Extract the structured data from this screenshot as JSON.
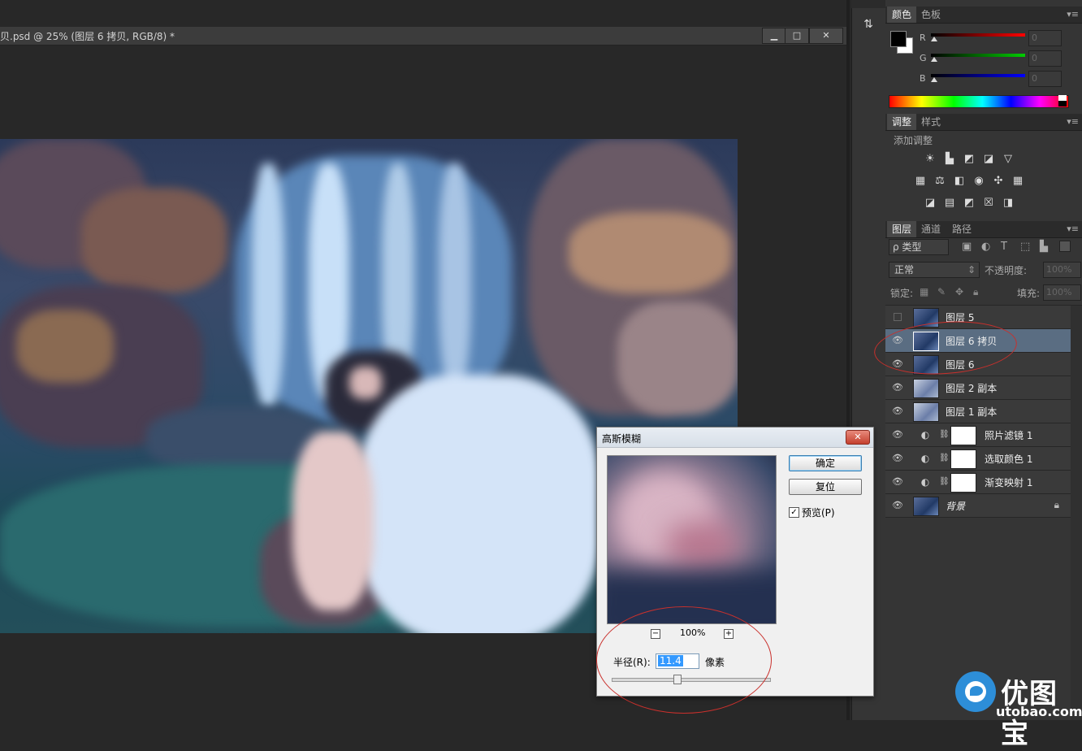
{
  "document": {
    "title": "贝.psd @ 25% (图层 6 拷贝, RGB/8) *",
    "btn_minimize": "▁",
    "btn_restore": "□",
    "btn_close": "✕"
  },
  "color_panel": {
    "tabs": [
      "颜色",
      "色板"
    ],
    "channels": [
      {
        "label": "R",
        "value": "0",
        "color": "#ff0000"
      },
      {
        "label": "G",
        "value": "0",
        "color": "#00cc00"
      },
      {
        "label": "B",
        "value": "0",
        "color": "#0000ff"
      }
    ],
    "foreground": "#000000",
    "background": "#ffffff"
  },
  "adjustments_panel": {
    "tabs": [
      "调整",
      "样式"
    ],
    "heading": "添加调整",
    "icons": [
      [
        "brightness-icon",
        "levels-icon",
        "curves-icon",
        "exposure-icon",
        "vibrance-icon"
      ],
      [
        "hue-saturation-icon",
        "color-balance-icon",
        "black-white-icon",
        "photo-filter-icon",
        "channel-mixer-icon",
        "color-lookup-icon"
      ],
      [
        "invert-icon",
        "posterize-icon",
        "threshold-icon",
        "gradient-map-icon",
        "selective-color-icon"
      ]
    ]
  },
  "layers_panel": {
    "tabs": [
      "图层",
      "通道",
      "路径"
    ],
    "filter_kind": "ρ 类型",
    "blend_mode": "正常",
    "opacity_label": "不透明度:",
    "opacity_value": "100%",
    "lock_label": "锁定:",
    "fill_label": "填充:",
    "fill_value": "100%",
    "layers": [
      {
        "name": "图层 5",
        "visible": false,
        "type": "pixel",
        "selected": false
      },
      {
        "name": "图层 6 拷贝",
        "visible": true,
        "type": "pixel",
        "selected": true
      },
      {
        "name": "图层 6",
        "visible": true,
        "type": "pixel",
        "selected": false
      },
      {
        "name": "图层 2 副本",
        "visible": true,
        "type": "pixel-light",
        "selected": false
      },
      {
        "name": "图层 1 副本",
        "visible": true,
        "type": "pixel-light",
        "selected": false
      },
      {
        "name": "照片滤镜 1",
        "visible": true,
        "type": "adjustment",
        "selected": false
      },
      {
        "name": "选取颜色 1",
        "visible": true,
        "type": "adjustment",
        "selected": false
      },
      {
        "name": "渐变映射 1",
        "visible": true,
        "type": "adjustment",
        "selected": false
      },
      {
        "name": "背景",
        "visible": true,
        "type": "background",
        "selected": false
      }
    ]
  },
  "gaussian_blur_dialog": {
    "title": "高斯模糊",
    "ok_label": "确定",
    "reset_label": "复位",
    "preview_label": "预览(P)",
    "preview_checked": true,
    "zoom_level": "100%",
    "zoom_out": "−",
    "zoom_in": "+",
    "radius_label": "半径(R):",
    "radius_value": "11.4",
    "unit_label": "像素",
    "close": "✕"
  },
  "watermark": {
    "brand": "优图宝",
    "url": "utobao.com"
  }
}
